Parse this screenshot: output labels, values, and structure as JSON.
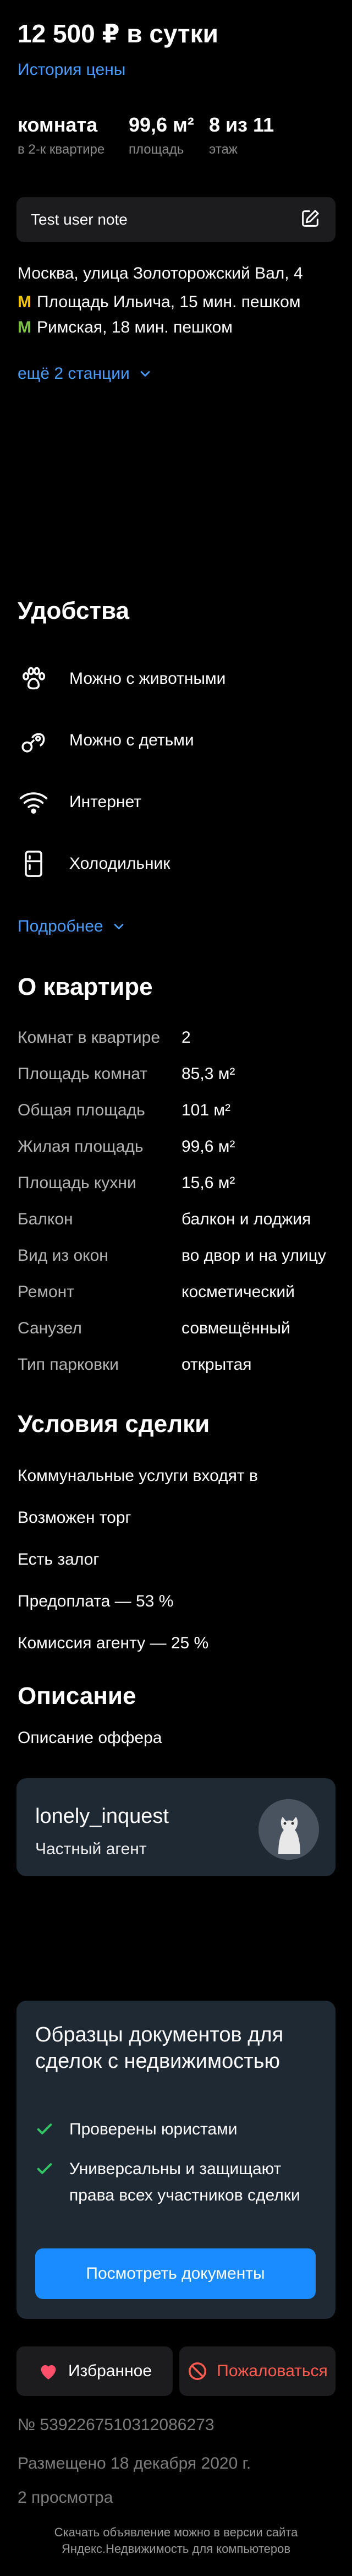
{
  "header": {
    "price": "12 500 ₽ в сутки",
    "price_history": "История цены",
    "params": [
      {
        "value": "комната",
        "caption": "в 2-к квартире"
      },
      {
        "value": "99,6 м²",
        "caption": "площадь"
      },
      {
        "value": "8 из 11",
        "caption": "этаж"
      }
    ]
  },
  "note": {
    "text": "Test user note",
    "icon": "edit-icon"
  },
  "location": {
    "address": "Москва, улица Золоторожский Вал, 4",
    "metro": [
      {
        "text": "Площадь Ильича, 15 мин. пешком",
        "color": "#f5c400"
      },
      {
        "text": "Римская, 18 мин. пешком",
        "color": "#7ec242"
      }
    ],
    "more_stations": "ещё 2 станции"
  },
  "amenities": {
    "title": "Удобства",
    "items": [
      {
        "label": "Можно с животными",
        "icon": "paw-icon"
      },
      {
        "label": "Можно с детьми",
        "icon": "pacifier-icon"
      },
      {
        "label": "Интернет",
        "icon": "wifi-icon"
      },
      {
        "label": "Холодильник",
        "icon": "fridge-icon"
      }
    ],
    "more": "Подробнее"
  },
  "about": {
    "title": "О квартире",
    "rows": [
      {
        "key": "Комнат в квартире",
        "value": "2"
      },
      {
        "key": "Площадь комнат",
        "value": "85,3 м²"
      },
      {
        "key": "Общая площадь",
        "value": "101 м²"
      },
      {
        "key": "Жилая площадь",
        "value": "99,6 м²"
      },
      {
        "key": "Площадь кухни",
        "value": "15,6 м²"
      },
      {
        "key": "Балкон",
        "value": "балкон и лоджия"
      },
      {
        "key": "Вид из окон",
        "value": "во двор и на улицу"
      },
      {
        "key": "Ремонт",
        "value": "косметический"
      },
      {
        "key": "Санузел",
        "value": "совмещённый"
      },
      {
        "key": "Тип парковки",
        "value": "открытая"
      }
    ]
  },
  "deal": {
    "title": "Условия сделки",
    "items": [
      "Коммунальные услуги входят в",
      "Возможен торг",
      "Есть залог",
      "Предоплата — 53 %",
      "Комиссия агенту — 25 %"
    ]
  },
  "description": {
    "title": "Описание",
    "text": "Описание оффера"
  },
  "agent": {
    "name": "lonely_inquest",
    "role": "Частный агент"
  },
  "docs_promo": {
    "title": "Образцы документов для сделок с недвижимостью",
    "items": [
      "Проверены юристами",
      "Универсальны и защищают права всех участников сделки"
    ],
    "button": "Посмотреть документы"
  },
  "actions": {
    "favorite": "Избранное",
    "complain": "Пожаловаться"
  },
  "meta": {
    "id": "№ 5392267510312086273",
    "posted": "Размещено 18 декабря 2020 г.",
    "views": "2 просмотра",
    "footer": "Скачать объявление можно в версии сайта Яндекс.Недвижимость для компьютеров"
  },
  "colors": {
    "accent": "#1a8cff",
    "link": "#4a9cff",
    "danger": "#ff5a4f",
    "card": "#1f2934"
  }
}
